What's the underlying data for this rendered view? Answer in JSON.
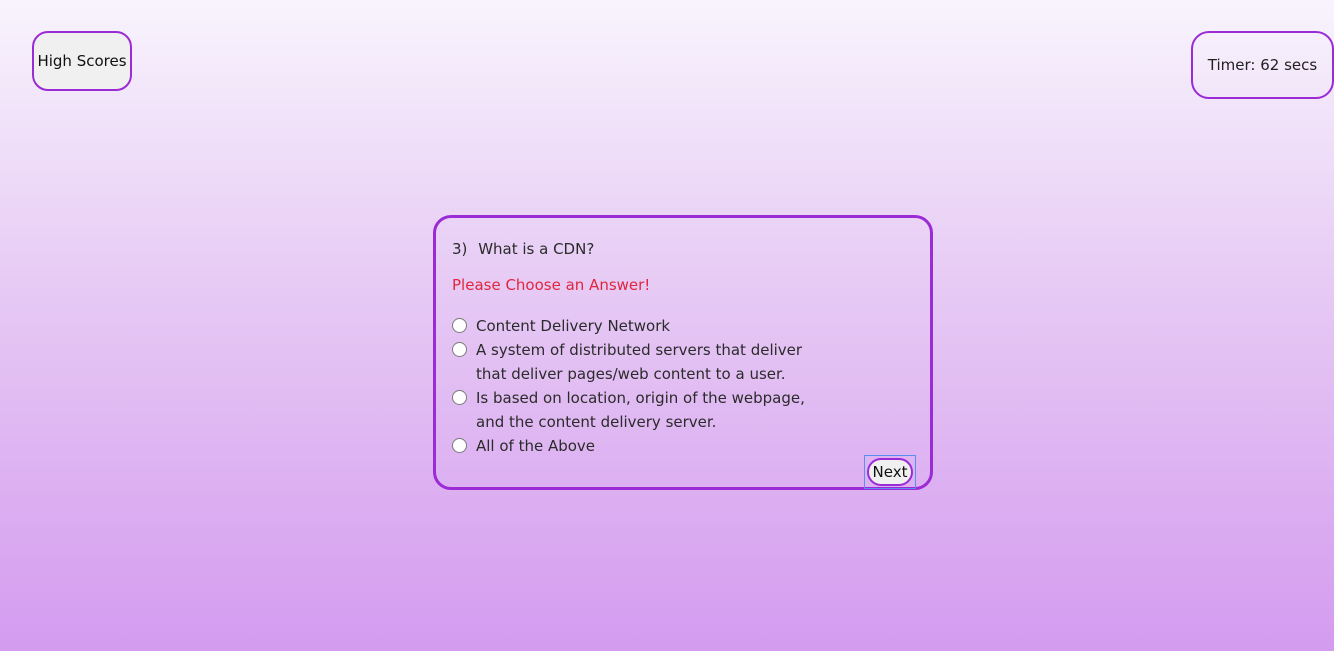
{
  "header": {
    "high_scores_label": "High Scores",
    "timer_text": "Timer: 62 secs"
  },
  "quiz": {
    "question_number": "3)",
    "question_text": "What is a CDN?",
    "warning_text": "Please Choose an Answer!",
    "answers": [
      {
        "label": "Content Delivery Network"
      },
      {
        "label": "A system of distributed servers that deliver that deliver pages/web content to a user."
      },
      {
        "label": "Is based on location, origin of the webpage, and the content delivery server."
      },
      {
        "label": "All of the Above"
      }
    ],
    "next_label": "Next"
  },
  "colors": {
    "accent": "#9b2bd4",
    "warning": "#e0263f",
    "focus_ring": "#5b8ef0"
  }
}
